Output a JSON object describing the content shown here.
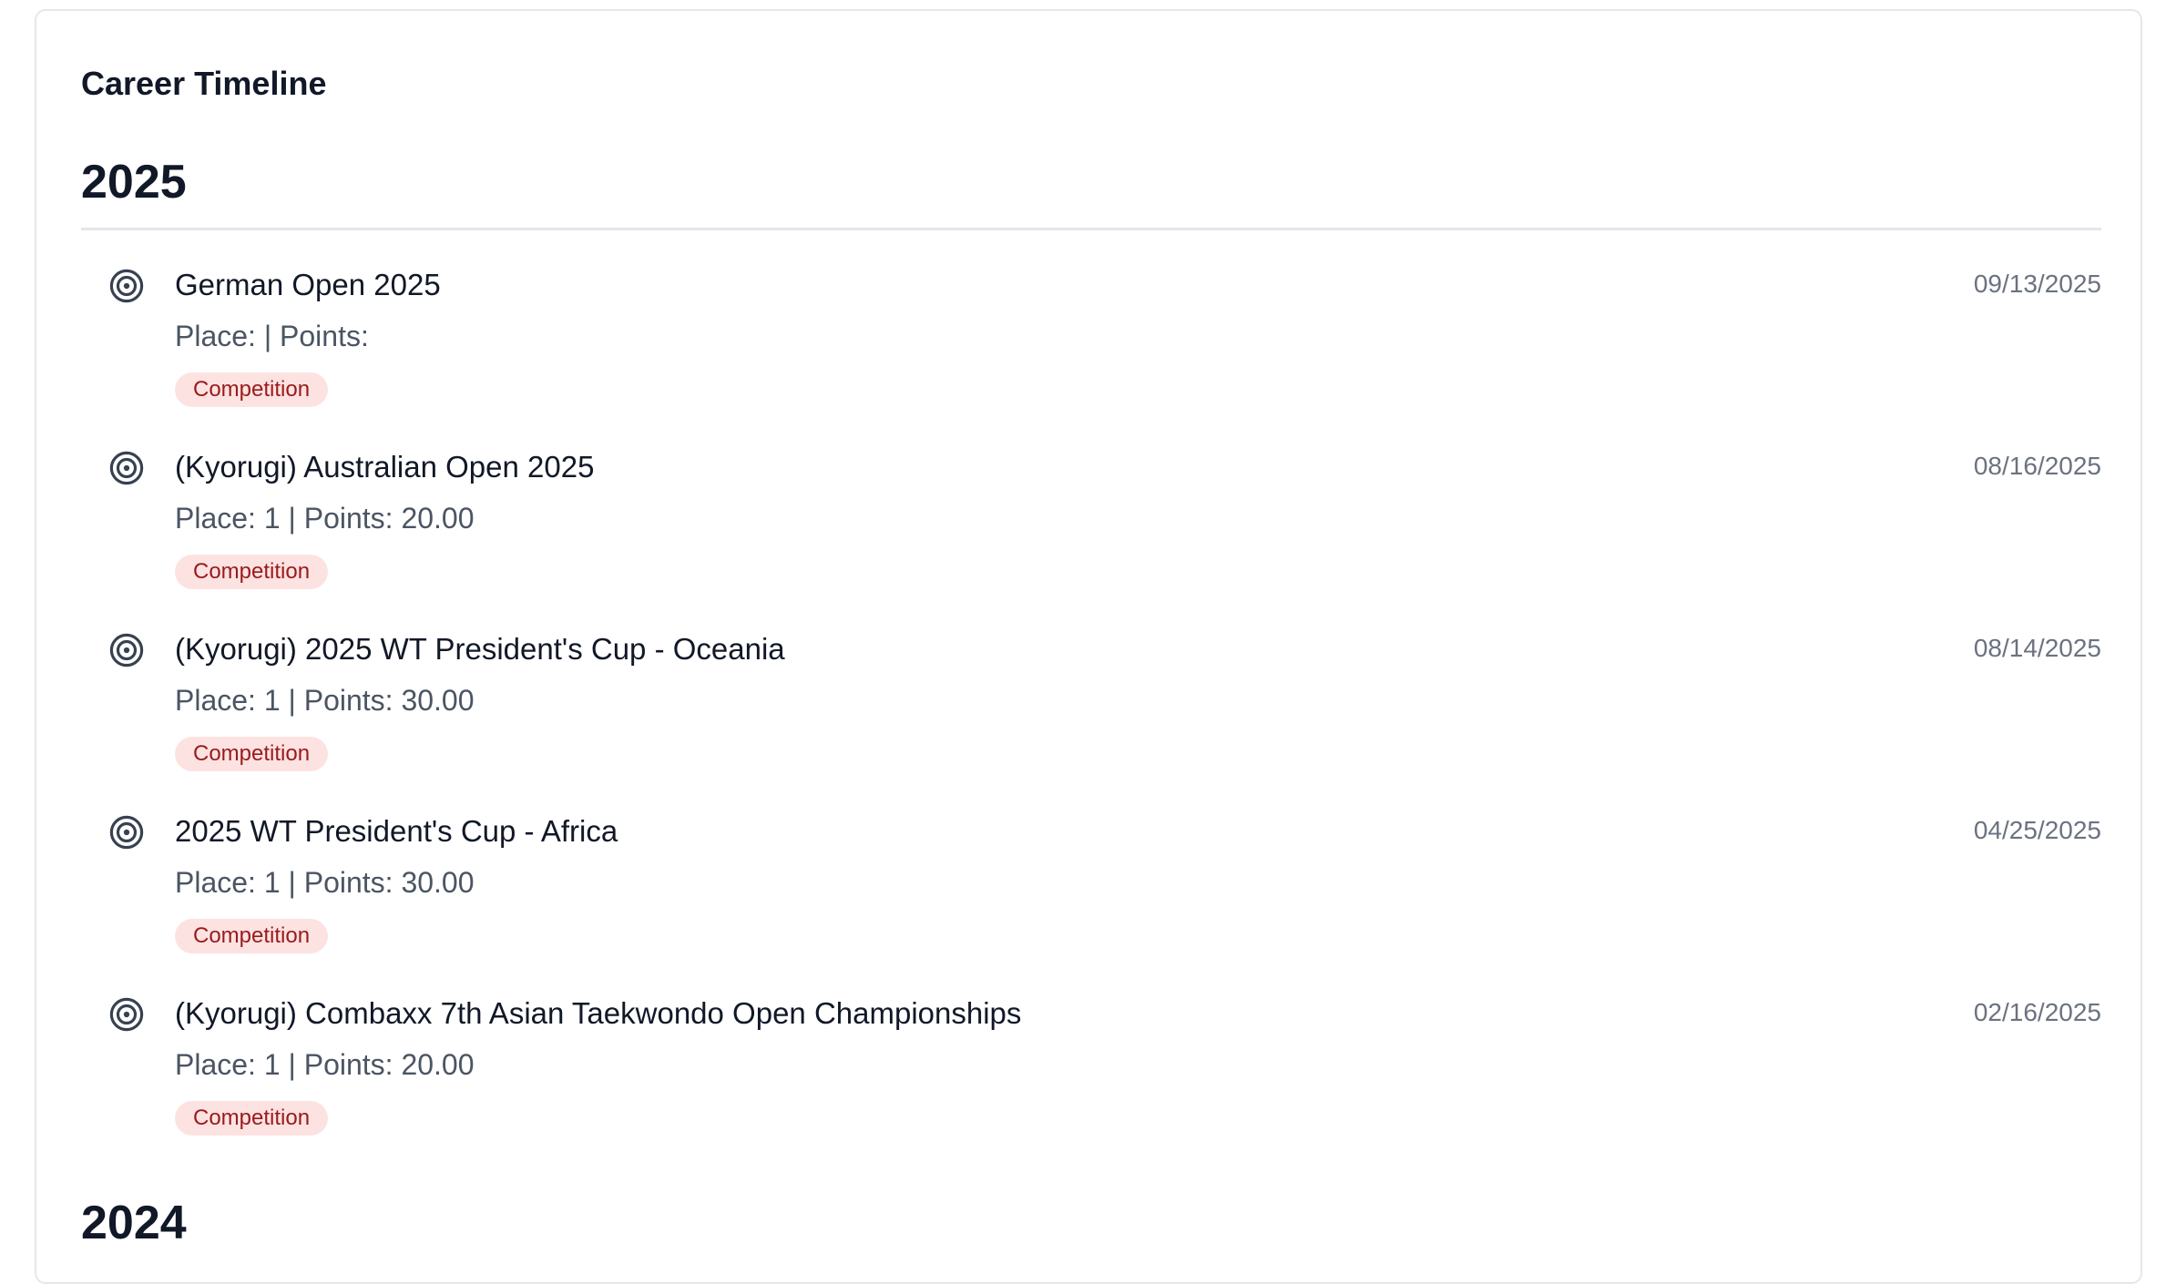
{
  "card": {
    "title": "Career Timeline"
  },
  "years": [
    {
      "year": "2025",
      "events": [
        {
          "icon": "target-icon",
          "title": "German Open 2025",
          "meta": "Place:  | Points: ",
          "date": "09/13/2025",
          "badge": "Competition"
        },
        {
          "icon": "target-icon",
          "title": "(Kyorugi) Australian Open 2025",
          "meta": "Place: 1 | Points: 20.00",
          "date": "08/16/2025",
          "badge": "Competition"
        },
        {
          "icon": "target-icon",
          "title": "(Kyorugi) 2025 WT President's Cup - Oceania",
          "meta": "Place: 1 | Points: 30.00",
          "date": "08/14/2025",
          "badge": "Competition"
        },
        {
          "icon": "target-icon",
          "title": "2025 WT President's Cup - Africa",
          "meta": "Place: 1 | Points: 30.00",
          "date": "04/25/2025",
          "badge": "Competition"
        },
        {
          "icon": "target-icon",
          "title": "(Kyorugi) Combaxx 7th Asian Taekwondo Open Championships",
          "meta": "Place: 1 | Points: 20.00",
          "date": "02/16/2025",
          "badge": "Competition"
        }
      ]
    }
  ],
  "next_year": "2024",
  "colors": {
    "badge_bg": "#fde2e2",
    "badge_text": "#991b1b",
    "date_text": "#6b7280",
    "meta_text": "#4b5563",
    "divider": "#e5e7eb"
  }
}
